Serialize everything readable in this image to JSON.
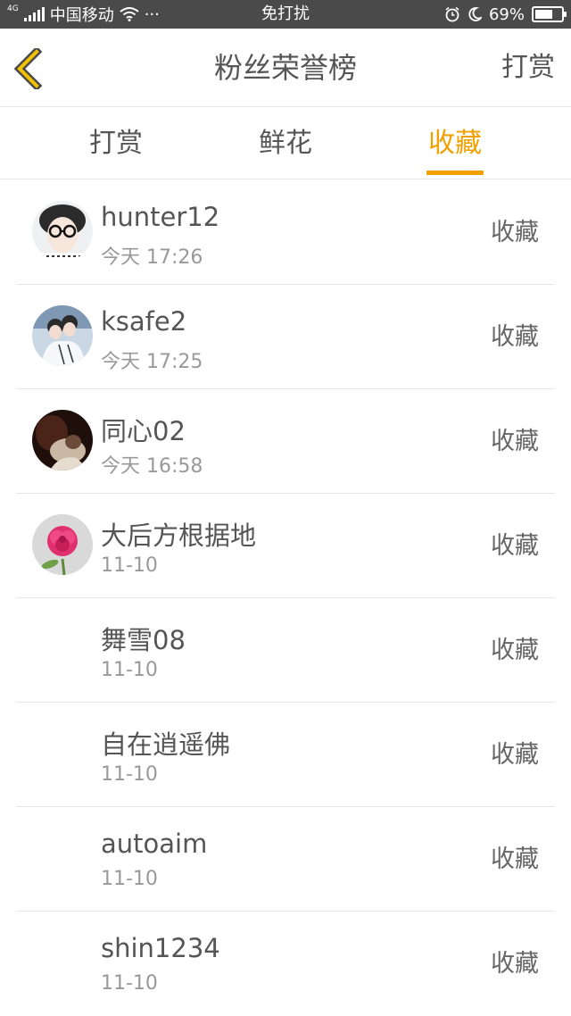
{
  "status_bar": {
    "net_tag": "4G",
    "carrier": "中国移动",
    "more": "···",
    "mode": "免打扰",
    "battery_text": "69%",
    "battery_level": 0.69,
    "icons": [
      "signal-icon",
      "wifi-icon",
      "alarm-icon",
      "moon-icon",
      "battery-icon"
    ]
  },
  "header": {
    "back_icon": "chevron-left-icon",
    "title": "粉丝荣誉榜",
    "action": "打赏"
  },
  "colors": {
    "accent": "#f0a000",
    "text": "#555555",
    "subtext": "#999999",
    "status_bar_bg": "#4a4a4a"
  },
  "tabs": [
    {
      "label": "打赏",
      "active": false
    },
    {
      "label": "鲜花",
      "active": false
    },
    {
      "label": "收藏",
      "active": true
    }
  ],
  "rows": [
    {
      "name": "hunter12",
      "time": "今天 17:26",
      "action": "收藏",
      "avatar": "avatar-glasses"
    },
    {
      "name": "ksafe2",
      "time": "今天 17:25",
      "action": "收藏",
      "avatar": "avatar-couple"
    },
    {
      "name": "同心02",
      "time": "今天 16:58",
      "action": "收藏",
      "avatar": "avatar-dark"
    },
    {
      "name": "大后方根据地",
      "time": "11-10",
      "action": "收藏",
      "avatar": "avatar-rose"
    },
    {
      "name": "舞雪08",
      "time": "11-10",
      "action": "收藏",
      "avatar": ""
    },
    {
      "name": "自在逍遥佛",
      "time": "11-10",
      "action": "收藏",
      "avatar": ""
    },
    {
      "name": "autoaim",
      "time": "11-10",
      "action": "收藏",
      "avatar": ""
    },
    {
      "name": "shin1234",
      "time": "11-10",
      "action": "收藏",
      "avatar": ""
    }
  ]
}
